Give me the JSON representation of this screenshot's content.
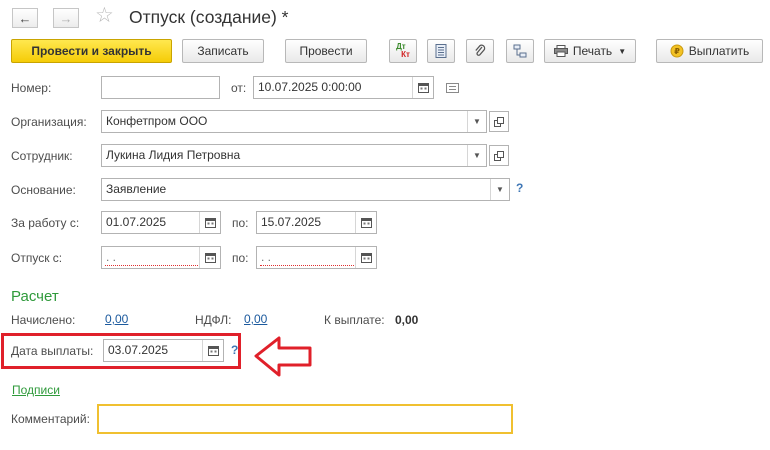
{
  "window": {
    "title": "Отпуск (создание) *"
  },
  "toolbar": {
    "post_close_label": "Провести и закрыть",
    "write_label": "Записать",
    "post_label": "Провести",
    "dtkt_top": "Дт",
    "dtkt_bottom": "Кт",
    "print_label": "Печать",
    "pay_label": "Выплатить"
  },
  "form": {
    "number": {
      "label": "Номер:",
      "value": ""
    },
    "date": {
      "label": "от:",
      "value": "10.07.2025  0:00:00"
    },
    "organization": {
      "label": "Организация:",
      "value": "Конфетпром ООО"
    },
    "employee": {
      "label": "Сотрудник:",
      "value": "Лукина Лидия Петровна"
    },
    "basis": {
      "label": "Основание:",
      "value": "Заявление",
      "help": "?"
    },
    "work_period": {
      "label": "За работу с:",
      "from": "01.07.2025",
      "to_label": "по:",
      "to": "15.07.2025"
    },
    "vacation": {
      "label": "Отпуск с:",
      "from": " .  .",
      "to_label": "по:",
      "to": " .  ."
    }
  },
  "calculation": {
    "section_title": "Расчет",
    "accrued_label": "Начислено:",
    "accrued_value": "0,00",
    "ndfl_label": "НДФЛ:",
    "ndfl_value": "0,00",
    "payout_label": "К выплате:",
    "payout_value": "0,00",
    "pay_date_label": "Дата выплаты:",
    "pay_date_value": "03.07.2025",
    "pay_date_help": "?"
  },
  "signatures_link": "Подписи",
  "comment": {
    "label": "Комментарий:",
    "value": ""
  },
  "colors": {
    "primary_button": "#f5cc07",
    "section_title": "#2f9a3b",
    "link": "#1c5a9e",
    "highlight_box": "#e0202a",
    "comment_border": "#f0c030"
  }
}
